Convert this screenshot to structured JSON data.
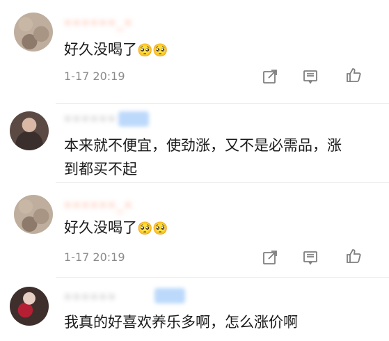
{
  "comments": [
    {
      "username": "••••••_•",
      "badge": false,
      "text": "好久没喝了",
      "emoji": "🥺🥺",
      "time": "1-17 20:19"
    },
    {
      "username": "••••••",
      "badge": true,
      "text_line1": "本来就不便宜，使劲涨，又不是必需品，涨",
      "text_line2": "到都买不起"
    },
    {
      "username": "••••••_•",
      "badge": false,
      "text": "好久没喝了",
      "emoji": "🥺🥺",
      "time": "1-17 20:19"
    },
    {
      "username": "••••••",
      "badge": true,
      "text": "我真的好喜欢养乐多啊，怎么涨价啊"
    }
  ],
  "actions": {
    "share_icon": "share-icon",
    "comment_icon": "comment-icon",
    "like_icon": "like-icon"
  }
}
